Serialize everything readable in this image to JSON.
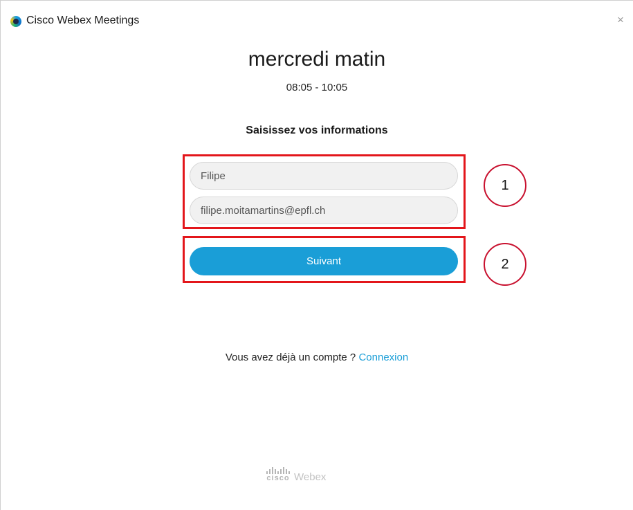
{
  "window": {
    "title": "Cisco Webex Meetings",
    "close_glyph": "×"
  },
  "meeting": {
    "title": "mercredi matin",
    "time": "08:05 - 10:05"
  },
  "form": {
    "heading": "Saisissez vos informations",
    "name_value": "Filipe",
    "email_value": "filipe.moitamartins@epfl.ch",
    "next_label": "Suivant"
  },
  "annotations": {
    "callout_1": "1",
    "callout_2": "2",
    "highlight_color": "#e3161b"
  },
  "account": {
    "prompt": "Vous avez déjà un compte ?",
    "login_label": "Connexion"
  },
  "branding": {
    "cisco": "cisco",
    "product": "Webex"
  },
  "colors": {
    "accent": "#1a9ed7"
  },
  "icons": {
    "app": "webex-logo-icon",
    "close": "close-icon",
    "brand": "cisco-bars-icon"
  }
}
